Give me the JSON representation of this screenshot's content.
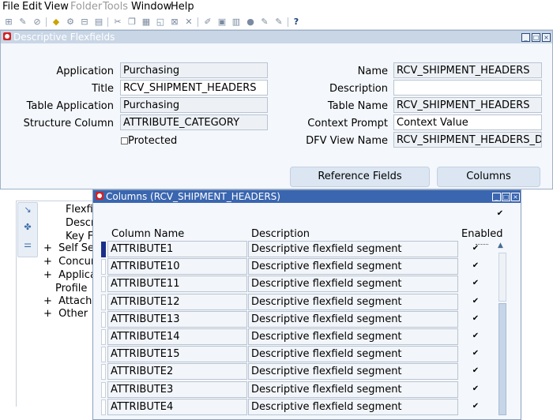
{
  "menubar": {
    "items": [
      {
        "label": "File",
        "enabled": true
      },
      {
        "label": "Edit",
        "enabled": true
      },
      {
        "label": "View",
        "enabled": true
      },
      {
        "label": "Folder",
        "enabled": false
      },
      {
        "label": "Tools",
        "enabled": false
      },
      {
        "label": "Window",
        "enabled": true
      },
      {
        "label": "Help",
        "enabled": true
      }
    ]
  },
  "toolbar": {
    "icons": [
      "new-icon",
      "find-icon",
      "navigator-icon",
      "save-icon",
      "print-icon",
      "close-form-icon",
      "cut-icon",
      "copy-icon",
      "paste-icon",
      "clear-icon",
      "delete-icon",
      "edit-field-icon",
      "zoom-icon",
      "translations-icon",
      "attachments-icon",
      "folder-tools-icon",
      "help-icon"
    ],
    "help_glyph": "?"
  },
  "navigator_bg": {
    "items": [
      {
        "text": "Flexfi",
        "prefix": ""
      },
      {
        "text": "Descr",
        "prefix": ""
      },
      {
        "text": "Key F",
        "prefix": ""
      },
      {
        "text": "Self Ser",
        "prefix": "+"
      },
      {
        "text": "Concur",
        "prefix": "+"
      },
      {
        "text": "Applica",
        "prefix": "+"
      },
      {
        "text": "Profile",
        "prefix": ""
      },
      {
        "text": "Attachn",
        "prefix": "+"
      },
      {
        "text": "Other",
        "prefix": "+"
      }
    ]
  },
  "dff_window": {
    "title": "Descriptive Flexfields",
    "fields": {
      "application": {
        "label": "Application",
        "value": "Purchasing"
      },
      "title": {
        "label": "Title",
        "value": "RCV_SHIPMENT_HEADERS"
      },
      "table_application": {
        "label": "Table Application",
        "value": "Purchasing"
      },
      "structure_column": {
        "label": "Structure Column",
        "value": "ATTRIBUTE_CATEGORY"
      },
      "protected": {
        "label": "Protected",
        "checked": false
      },
      "name": {
        "label": "Name",
        "value": "RCV_SHIPMENT_HEADERS"
      },
      "description": {
        "label": "Description",
        "value": ""
      },
      "table_name": {
        "label": "Table Name",
        "value": "RCV_SHIPMENT_HEADERS"
      },
      "context_prompt": {
        "label": "Context Prompt",
        "value": "Context Value"
      },
      "dfv_view_name": {
        "label": "DFV View Name",
        "value": "RCV_SHIPMENT_HEADERS_DFV"
      }
    },
    "buttons": {
      "reference_fields": "Reference Fields",
      "columns": "Columns"
    }
  },
  "columns_window": {
    "title": "Columns (RCV_SHIPMENT_HEADERS)",
    "headers": {
      "column_name": "Column Name",
      "description": "Description",
      "enabled": "Enabled"
    },
    "header_checkbox": true,
    "rows": [
      {
        "column_name": "ATTRIBUTE1",
        "description": "Descriptive flexfield segment",
        "enabled": true,
        "current": true
      },
      {
        "column_name": "ATTRIBUTE10",
        "description": "Descriptive flexfield segment",
        "enabled": true,
        "current": false
      },
      {
        "column_name": "ATTRIBUTE11",
        "description": "Descriptive flexfield segment",
        "enabled": true,
        "current": false
      },
      {
        "column_name": "ATTRIBUTE12",
        "description": "Descriptive flexfield segment",
        "enabled": true,
        "current": false
      },
      {
        "column_name": "ATTRIBUTE13",
        "description": "Descriptive flexfield segment",
        "enabled": true,
        "current": false
      },
      {
        "column_name": "ATTRIBUTE14",
        "description": "Descriptive flexfield segment",
        "enabled": true,
        "current": false
      },
      {
        "column_name": "ATTRIBUTE15",
        "description": "Descriptive flexfield segment",
        "enabled": true,
        "current": false
      },
      {
        "column_name": "ATTRIBUTE2",
        "description": "Descriptive flexfield segment",
        "enabled": true,
        "current": false
      },
      {
        "column_name": "ATTRIBUTE3",
        "description": "Descriptive flexfield segment",
        "enabled": true,
        "current": false
      },
      {
        "column_name": "ATTRIBUTE4",
        "description": "Descriptive flexfield segment",
        "enabled": true,
        "current": false
      }
    ]
  },
  "colors": {
    "title_active": "#3a66b0",
    "title_inactive": "#c9d6e6",
    "window_bg": "#f4f7fb",
    "readonly_field": "#edf1f6",
    "button_bg": "#dbe6f2",
    "record_indicator": "#1a2f8a",
    "oracle_red": "#d42020"
  }
}
